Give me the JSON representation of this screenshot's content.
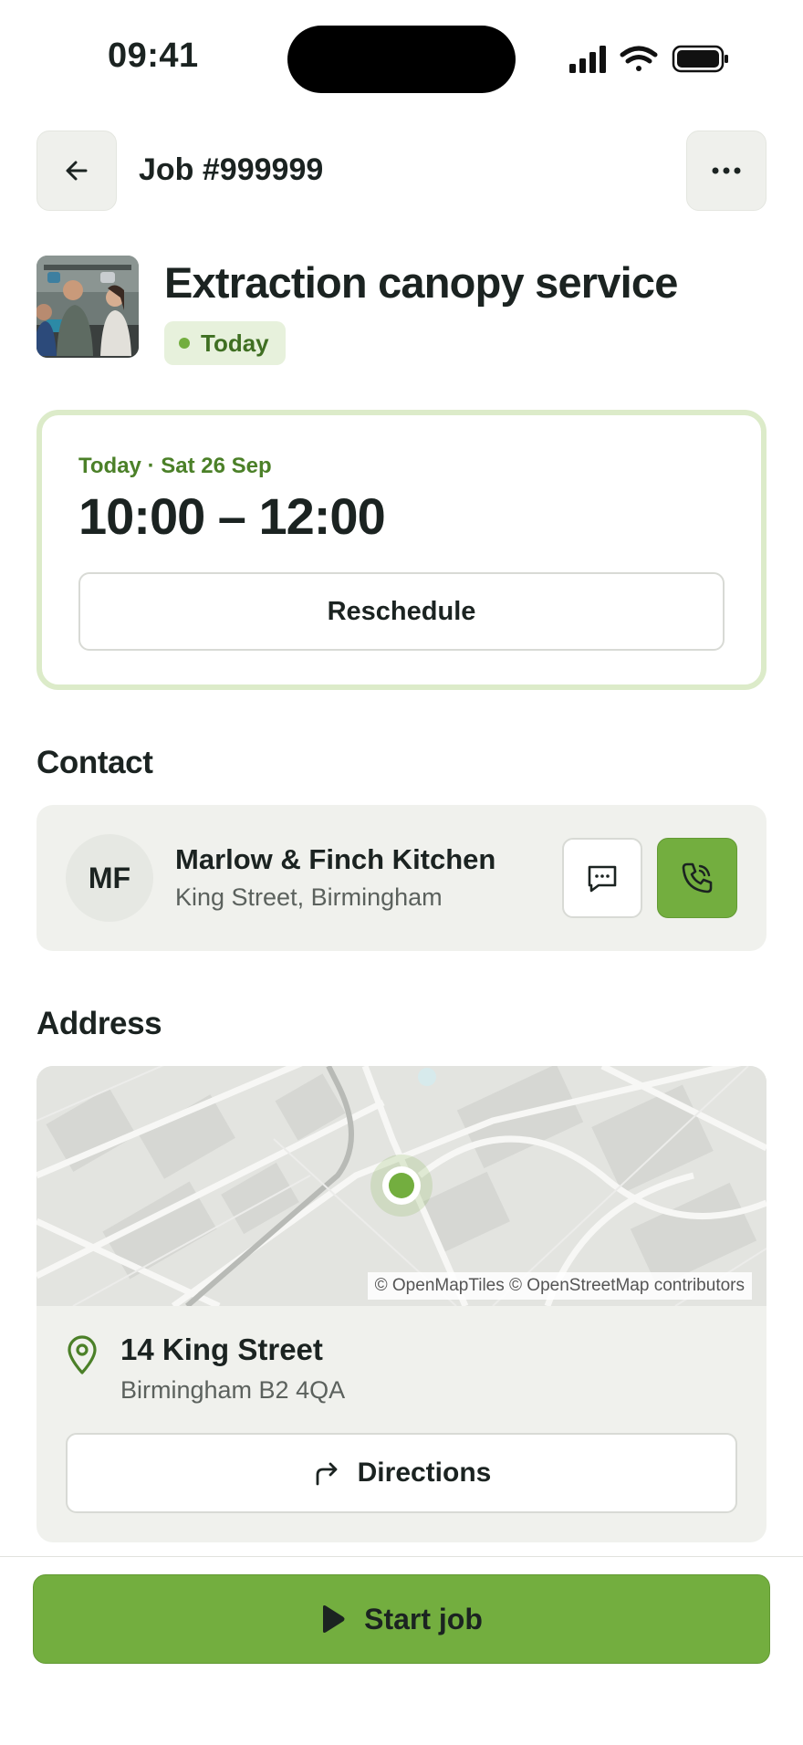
{
  "status_bar": {
    "time": "09:41"
  },
  "header": {
    "job_number": "Job #999999"
  },
  "job": {
    "title": "Extraction canopy service",
    "badge": "Today"
  },
  "schedule": {
    "date": "Today · Sat 26 Sep",
    "time_range": "10:00 – 12:00",
    "reschedule_label": "Reschedule"
  },
  "contact": {
    "heading": "Contact",
    "initials": "MF",
    "name": "Marlow & Finch Kitchen",
    "address": "King Street, Birmingham"
  },
  "address": {
    "heading": "Address",
    "map_attribution": "© OpenMapTiles © OpenStreetMap contributors",
    "street": "14 King Street",
    "city": "Birmingham B2 4QA",
    "directions_label": "Directions"
  },
  "actions": {
    "start_label": "Start job"
  },
  "colors": {
    "accent": "#73ae3f",
    "accent_light": "#dcebc9",
    "text": "#1b2321",
    "card_bg": "#f0f1ed"
  },
  "icons": [
    "back-arrow-icon",
    "more-icon",
    "message-icon",
    "phone-icon",
    "location-pin-icon",
    "directions-icon",
    "play-icon"
  ]
}
